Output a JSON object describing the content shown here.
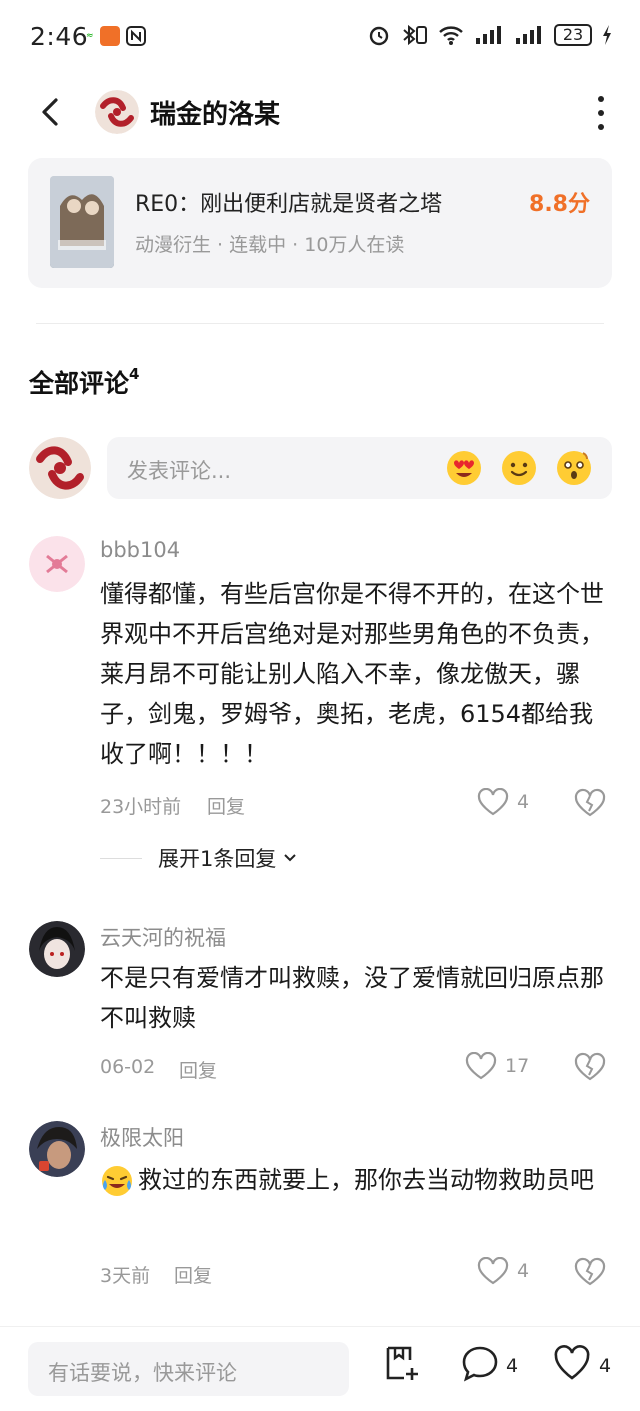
{
  "status_bar": {
    "time": "2:46",
    "battery": "23"
  },
  "header": {
    "title": "瑞金的洛某"
  },
  "book": {
    "title": "RE0：刚出便利店就是贤者之塔",
    "meta": "动漫衍生 · 连载中 · 10万人在读",
    "score": "8.8分"
  },
  "comments_section": {
    "title": "全部评论",
    "count": "4"
  },
  "comment_input": {
    "placeholder": "发表评论..."
  },
  "comments": [
    {
      "user": "bbb104",
      "text": "懂得都懂，有些后宫你是不得不开的，在这个世界观中不开后宫绝对是对那些男角色的不负责，莱月昂不可能让别人陷入不幸，像龙傲天，骡子，剑鬼，罗姆爷，奥拓，老虎，6154都给我收了啊！！！！",
      "time": "23小时前",
      "reply_label": "回复",
      "likes": "4",
      "expand": "展开1条回复"
    },
    {
      "user": "云天河的祝福",
      "text": "不是只有爱情才叫救赎，没了爱情就回归原点那不叫救赎",
      "time": "06-02",
      "reply_label": "回复",
      "likes": "17"
    },
    {
      "user": "极限太阳",
      "text": "救过的东西就要上，那你去当动物救助员吧",
      "time": "3天前",
      "reply_label": "回复",
      "likes": "4"
    }
  ],
  "bottom_bar": {
    "placeholder": "有话要说，快来评论",
    "comment_count": "4",
    "like_count": "4"
  },
  "colors": {
    "accent_score": "#f07028",
    "muted_text": "#999999",
    "card_bg": "#f4f4f6"
  }
}
